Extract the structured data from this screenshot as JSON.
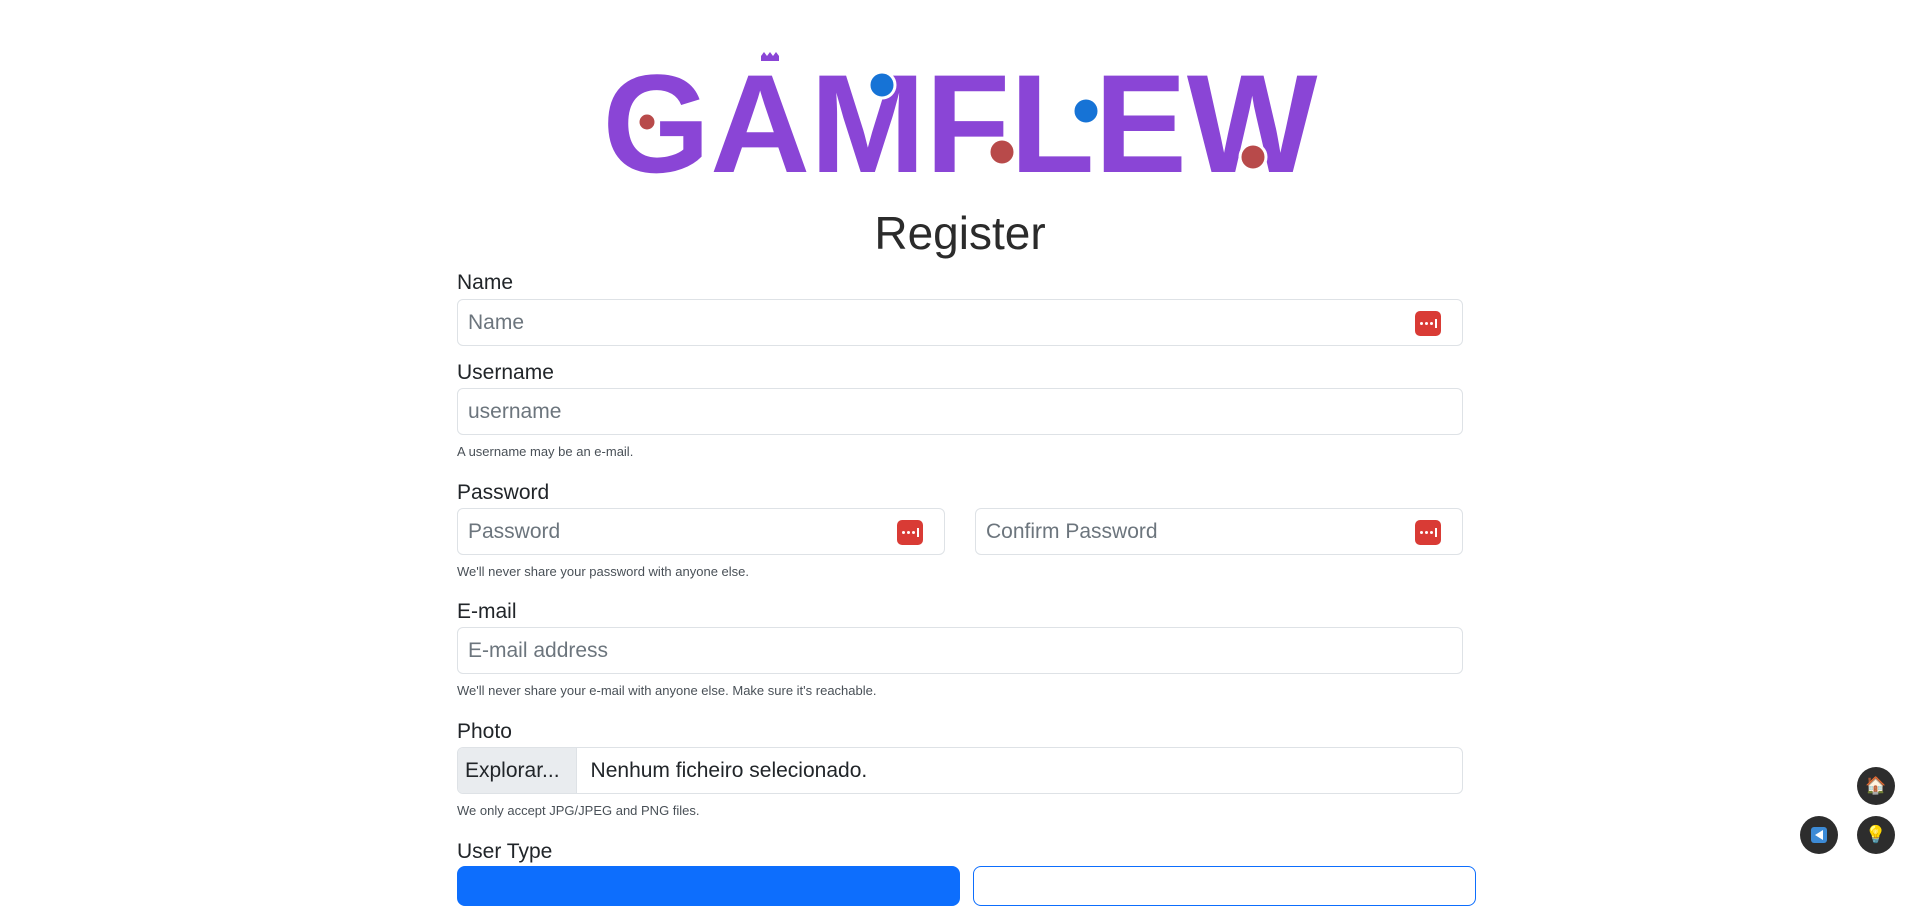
{
  "logo": {
    "text": "GAMFLEW",
    "brand_color": "#8a45d6",
    "dot_blue": "#1673d6",
    "dot_red": "#b84a4a"
  },
  "page_title": "Register",
  "form": {
    "name": {
      "label": "Name",
      "placeholder": "Name"
    },
    "username": {
      "label": "Username",
      "placeholder": "username",
      "help": "A username may be an e-mail."
    },
    "password": {
      "label": "Password",
      "placeholder": "Password",
      "confirm_placeholder": "Confirm Password",
      "help": "We'll never share your password with anyone else."
    },
    "email": {
      "label": "E-mail",
      "placeholder": "E-mail address",
      "help": "We'll never share your e-mail with anyone else. Make sure it's reachable."
    },
    "photo": {
      "label": "Photo",
      "button": "Explorar...",
      "file_name": "Nenhum ficheiro selecionado.",
      "help": "We only accept JPG/JPEG and PNG files."
    },
    "user_type": {
      "label": "User Type"
    }
  },
  "colors": {
    "primary": "#0d6efd",
    "password_manager": "#d93b35",
    "fab_bg": "#2d2d2d"
  },
  "floating_buttons": [
    {
      "name": "home-fab",
      "icon": "house-icon"
    },
    {
      "name": "send-fab",
      "icon": "send-icon"
    },
    {
      "name": "tip-fab",
      "icon": "lightbulb-icon"
    }
  ]
}
